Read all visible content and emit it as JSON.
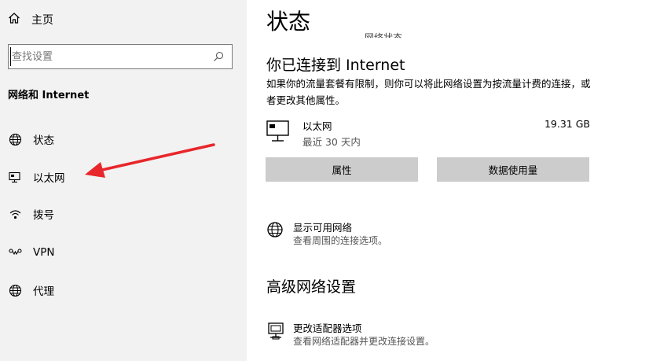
{
  "sidebar": {
    "home_label": "主页",
    "search_placeholder": "查找设置",
    "section_title": "网络和 Internet",
    "items": [
      {
        "label": "状态",
        "icon": "globe-icon"
      },
      {
        "label": "以太网",
        "icon": "ethernet-icon"
      },
      {
        "label": "拨号",
        "icon": "dialup-icon"
      },
      {
        "label": "VPN",
        "icon": "vpn-icon"
      },
      {
        "label": "代理",
        "icon": "proxy-globe-icon"
      }
    ]
  },
  "main": {
    "title": "状态",
    "clipped_text": "网络状态",
    "connected_heading": "你已连接到 Internet",
    "connected_desc": "如果你的流量套餐有限制，则你可以将此网络设置为按流量计费的连接，或者更改其他属性。",
    "ethernet": {
      "name": "以太网",
      "period": "最近 30 天内",
      "usage": "19.31 GB"
    },
    "buttons": {
      "properties": "属性",
      "data_usage": "数据使用量"
    },
    "show_networks": {
      "title": "显示可用网络",
      "subtitle": "查看周围的连接选项。"
    },
    "advanced_heading": "高级网络设置",
    "adapter_options": {
      "title": "更改适配器选项",
      "subtitle": "查看网络适配器并更改连接设置。"
    }
  },
  "colors": {
    "sidebar_bg": "#f2f2f2",
    "button_bg": "#cccccc",
    "annotation_arrow": "#e8262b"
  }
}
